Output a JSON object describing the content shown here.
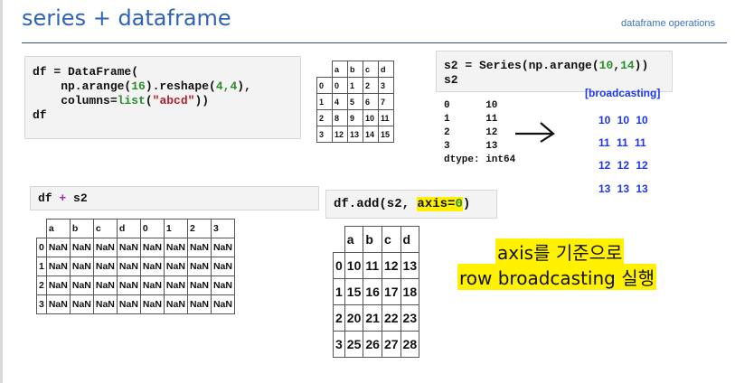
{
  "page": {
    "title": "series + dataframe",
    "subtitle": "dataframe operations"
  },
  "code1": {
    "l1": "df = DataFrame(",
    "l2a": "    np.arange(",
    "l2n": "16",
    "l2b": ").reshape(",
    "l2c": "4,4",
    "l2d": "),",
    "l3a": "    columns=",
    "l3b": "list",
    "l3c": "(",
    "l3s": "\"abcd\"",
    "l3d": "))",
    "l4": "df"
  },
  "df_table": {
    "columns": [
      "a",
      "b",
      "c",
      "d"
    ],
    "rows": [
      {
        "idx": "0",
        "vals": [
          "0",
          "1",
          "2",
          "3"
        ]
      },
      {
        "idx": "1",
        "vals": [
          "4",
          "5",
          "6",
          "7"
        ]
      },
      {
        "idx": "2",
        "vals": [
          "8",
          "9",
          "10",
          "11"
        ]
      },
      {
        "idx": "3",
        "vals": [
          "12",
          "13",
          "14",
          "15"
        ]
      }
    ]
  },
  "code2": {
    "l1a": "s2 = Series(np.arange(",
    "l1n1": "10",
    "l1c": ",",
    "l1n2": "14",
    "l1d": "))",
    "l2": "s2"
  },
  "s2_output": {
    "lines": [
      "0      10",
      "1      11",
      "2      12",
      "3      13",
      "dtype: int64"
    ]
  },
  "broadcast": {
    "label": "[broadcasting]",
    "rows": [
      "10  10  10",
      "11  11  11",
      "12  12  12",
      "13  13  13"
    ]
  },
  "code3": {
    "a": "df ",
    "op": "+",
    "b": " s2"
  },
  "sum_table": {
    "columns": [
      "a",
      "b",
      "c",
      "d",
      "0",
      "1",
      "2",
      "3"
    ],
    "rows": [
      {
        "idx": "0",
        "vals": [
          "NaN",
          "NaN",
          "NaN",
          "NaN",
          "NaN",
          "NaN",
          "NaN",
          "NaN"
        ]
      },
      {
        "idx": "1",
        "vals": [
          "NaN",
          "NaN",
          "NaN",
          "NaN",
          "NaN",
          "NaN",
          "NaN",
          "NaN"
        ]
      },
      {
        "idx": "2",
        "vals": [
          "NaN",
          "NaN",
          "NaN",
          "NaN",
          "NaN",
          "NaN",
          "NaN",
          "NaN"
        ]
      },
      {
        "idx": "3",
        "vals": [
          "NaN",
          "NaN",
          "NaN",
          "NaN",
          "NaN",
          "NaN",
          "NaN",
          "NaN"
        ]
      }
    ]
  },
  "code4": {
    "a": "df.add(s2, ",
    "hl_a": "axis=",
    "hl_n": "0",
    "b": ")"
  },
  "add_table": {
    "columns": [
      "a",
      "b",
      "c",
      "d"
    ],
    "rows": [
      {
        "idx": "0",
        "vals": [
          "10",
          "11",
          "12",
          "13"
        ]
      },
      {
        "idx": "1",
        "vals": [
          "15",
          "16",
          "17",
          "18"
        ]
      },
      {
        "idx": "2",
        "vals": [
          "20",
          "21",
          "22",
          "23"
        ]
      },
      {
        "idx": "3",
        "vals": [
          "25",
          "26",
          "27",
          "28"
        ]
      }
    ]
  },
  "annotation": {
    "line1": "axis를 기준으로",
    "line2": "row broadcasting 실행"
  }
}
